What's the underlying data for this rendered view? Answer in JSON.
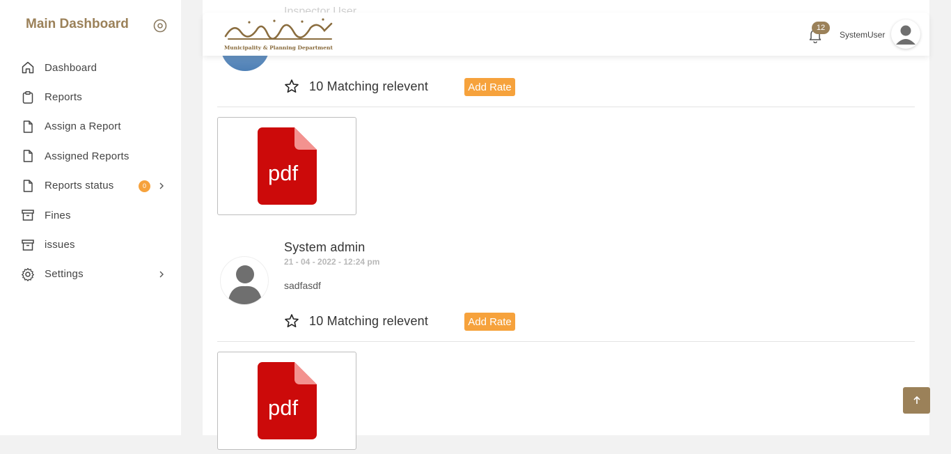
{
  "sidebar": {
    "title": "Main Dashboard",
    "items": [
      {
        "label": "Dashboard",
        "icon": "home-icon"
      },
      {
        "label": "Reports",
        "icon": "clipboard-icon"
      },
      {
        "label": "Assign a Report",
        "icon": "file-icon"
      },
      {
        "label": "Assigned Reports",
        "icon": "file-icon"
      },
      {
        "label": "Reports status",
        "icon": "file-icon",
        "badge": "0"
      },
      {
        "label": "Fines",
        "icon": "archive-icon"
      },
      {
        "label": "issues",
        "icon": "archive-icon"
      },
      {
        "label": "Settings",
        "icon": "gear-icon"
      }
    ]
  },
  "header": {
    "logo_subtitle": "Municipality & Planning Department",
    "notification_count": "12",
    "username": "SystemUser"
  },
  "comments": [
    {
      "name": "Inspector User",
      "rating_text": "10 Matching relevent",
      "add_rate_label": "Add Rate",
      "attachment_label": "pdf"
    },
    {
      "name": "System admin",
      "date": "21 - 04 - 2022 - 12:24 pm",
      "body": "sadfasdf",
      "rating_text": "10 Matching relevent",
      "add_rate_label": "Add Rate",
      "attachment_label": "pdf"
    }
  ],
  "colors": {
    "brand": "#9b8159",
    "accent": "#f6a23c",
    "pdf_red": "#cc0a0a"
  }
}
